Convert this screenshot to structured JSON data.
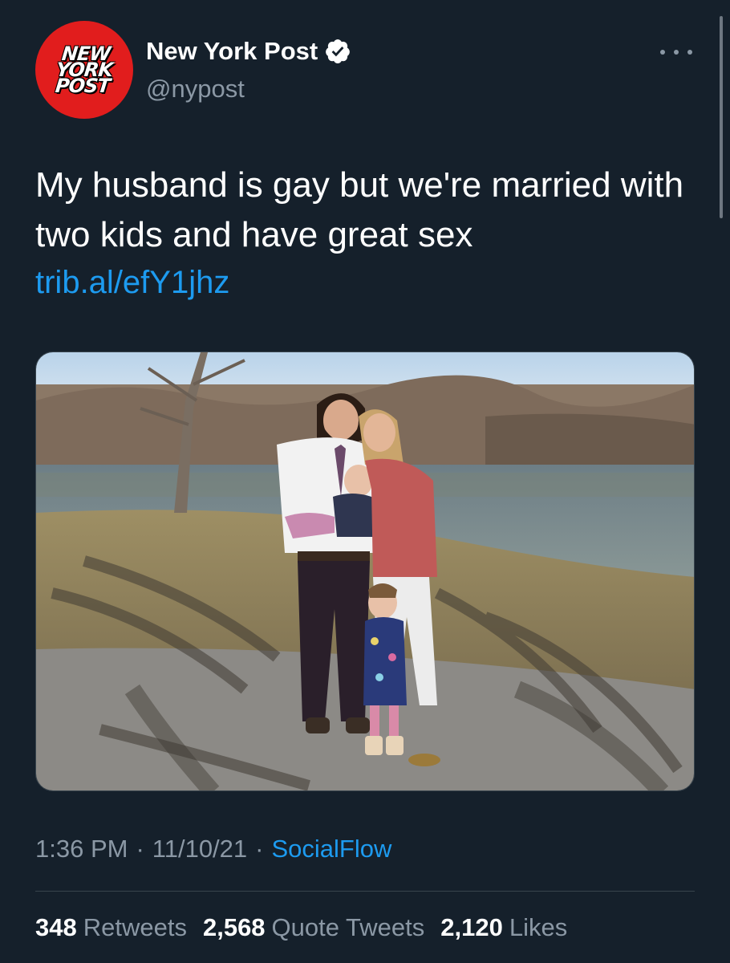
{
  "author": {
    "avatar_logo_lines": [
      "NEW",
      "YORK",
      "POST"
    ],
    "display_name": "New York Post",
    "handle": "@nypost",
    "verified": true,
    "verified_icon": "verified-badge-icon"
  },
  "tweet": {
    "text": "My husband is gay but we're married with two kids and have great sex",
    "link": "trib.al/efY1jhz",
    "media_icon": "family-photo-image"
  },
  "meta": {
    "time": "1:36 PM",
    "date": "11/10/21",
    "separator": "·",
    "source": "SocialFlow"
  },
  "stats": {
    "retweets": {
      "count": "348",
      "label": "Retweets"
    },
    "quote_tweets": {
      "count": "2,568",
      "label": "Quote Tweets"
    },
    "likes": {
      "count": "2,120",
      "label": "Likes"
    }
  },
  "colors": {
    "background": "#15202b",
    "accent": "#1d9bf0",
    "secondary_text": "#8b98a5",
    "avatar_red": "#e11d1d"
  }
}
